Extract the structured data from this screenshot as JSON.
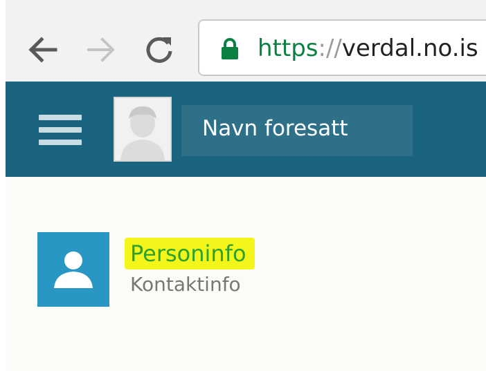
{
  "browser": {
    "back_icon": "arrow-left-icon",
    "forward_icon": "arrow-right-icon",
    "reload_icon": "reload-icon",
    "lock_icon": "lock-icon",
    "url_scheme": "https",
    "url_separator": "://",
    "url_host": "verdal.no.is",
    "secure_color": "#0b8043"
  },
  "header": {
    "background": "#1b6480",
    "menu_icon": "hamburger-menu-icon",
    "avatar_icon": "user-avatar-icon",
    "user_name": "Navn foresatt"
  },
  "main": {
    "tile": {
      "icon": "person-icon",
      "color": "#2997c4",
      "title": "Personinfo",
      "subtitle": "Kontaktinfo",
      "highlight_color": "#f4f51a"
    }
  }
}
